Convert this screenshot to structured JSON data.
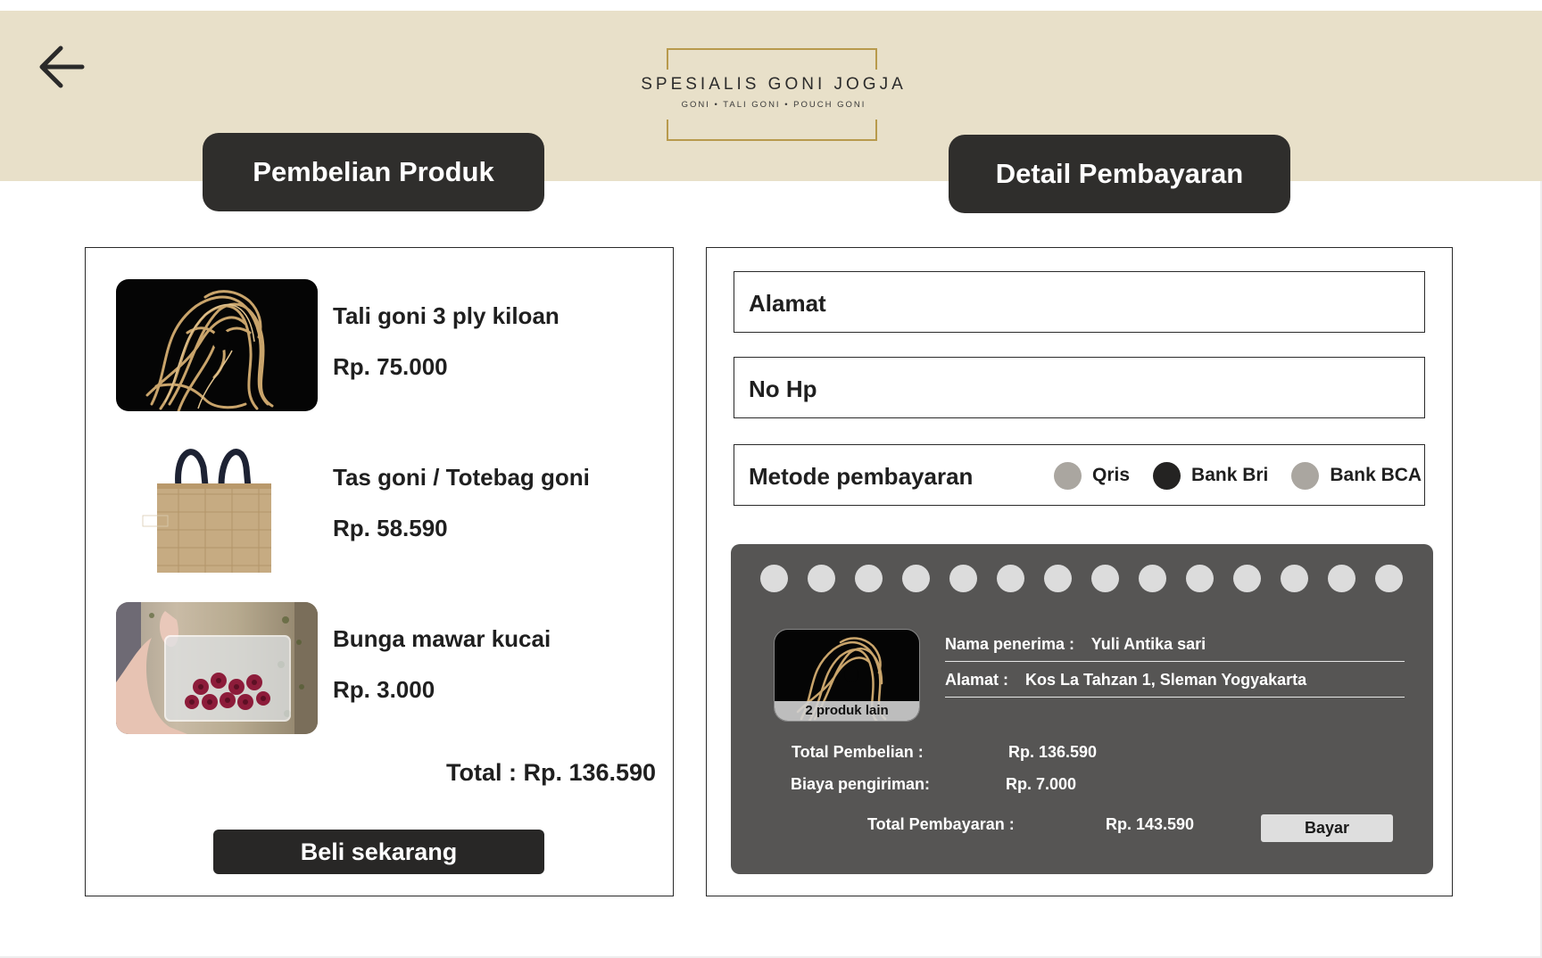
{
  "header": {
    "back_icon": "arrow-left-icon",
    "logo": {
      "name": "SPESIALIS GONI JOGJA",
      "tagline": "GONI  •  TALI GONI  •  POUCH GONI",
      "accent_color": "#b89a4c"
    },
    "band_color": "#e8e0c9"
  },
  "left_section": {
    "title": "Pembelian Produk",
    "products": [
      {
        "name": "Tali goni 3 ply kiloan",
        "price": "Rp. 75.000",
        "image": "jute-rope-image"
      },
      {
        "name": "Tas goni / Totebag goni",
        "price": "Rp. 58.590",
        "image": "jute-totebag-image"
      },
      {
        "name": "Bunga mawar kucai",
        "price": "Rp. 3.000",
        "image": "rose-pouch-image"
      }
    ],
    "total": "Total : Rp. 136.590",
    "buy_button": "Beli sekarang"
  },
  "right_section": {
    "title": "Detail Pembayaran",
    "address_field": "Alamat",
    "phone_field": "No Hp",
    "payment_method": {
      "label": "Metode pembayaran",
      "options": [
        {
          "label": "Qris",
          "selected": false
        },
        {
          "label": "Bank Bri",
          "selected": true
        },
        {
          "label": "Bank BCA",
          "selected": false
        }
      ]
    },
    "receipt": {
      "more_products": "2 produk lain",
      "recipient_key": "Nama penerima :",
      "recipient_value": "Yuli Antika sari",
      "address_key": "Alamat :",
      "address_value": "Kos La Tahzan 1, Sleman Yogyakarta",
      "purchase_total_label": "Total Pembelian :",
      "purchase_total_value": "Rp. 136.590",
      "shipping_label": "Biaya pengiriman:",
      "shipping_value": "Rp. 7.000",
      "payment_total_label": "Total Pembayaran :",
      "payment_total_value": "Rp. 143.590",
      "pay_button": "Bayar"
    }
  }
}
